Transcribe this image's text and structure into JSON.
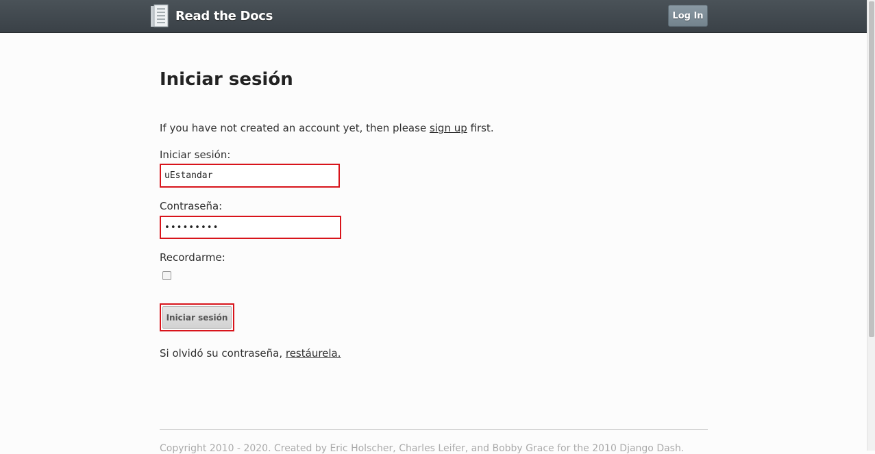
{
  "header": {
    "brand": "Read the Docs",
    "login_button": "Log In"
  },
  "page": {
    "title": "Iniciar sesión",
    "intro_before": "If you have not created an account yet, then please ",
    "intro_link": "sign up",
    "intro_after": " first.",
    "login_label": "Iniciar sesión:",
    "login_value": "uEstandar",
    "password_label": "Contraseña:",
    "password_value": "•••••••••",
    "remember_label": "Recordarme:",
    "remember_checked": false,
    "submit_label": "Iniciar sesión",
    "forgot_before": "Si olvidó su contraseña, ",
    "forgot_link": "restáurela."
  },
  "footer": {
    "text": "Copyright 2010 - 2020. Created by Eric Holscher, Charles Leifer, and Bobby Grace for the 2010 Django Dash."
  }
}
